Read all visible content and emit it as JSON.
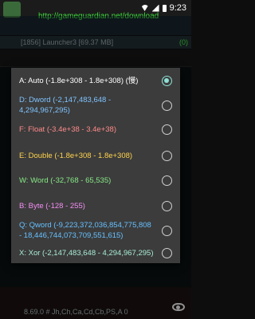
{
  "status_bar": {
    "time": "9:23"
  },
  "background": {
    "url": "http://gameguardian.net/download",
    "process": "[1856] Launcher3 [69.37 MB]",
    "count": "(0)",
    "bottom_text": "8.69.0 # Jh,Ch,Ca,Cd,Cb,PS,A 0"
  },
  "dialog": {
    "options": [
      {
        "label": "A: Auto (-1.8e+308 - 1.8e+308) (慢)",
        "color": "#ffffff",
        "selected": true
      },
      {
        "label": "D: Dword (-2,147,483,648 - 4,294,967,295)",
        "color": "#7fc4ff",
        "selected": false
      },
      {
        "label": "F: Float (-3.4e+38 - 3.4e+38)",
        "color": "#ff8a8a",
        "selected": false
      },
      {
        "label": "E: Double (-1.8e+308 - 1.8e+308)",
        "color": "#ffd34d",
        "selected": false
      },
      {
        "label": "W: Word (-32,768 - 65,535)",
        "color": "#86e986",
        "selected": false
      },
      {
        "label": "B: Byte (-128 - 255)",
        "color": "#f48ef4",
        "selected": false
      },
      {
        "label": "Q: Qword (-9,223,372,036,854,775,808 - 18,446,744,073,709,551,615)",
        "color": "#66c0ff",
        "selected": false
      },
      {
        "label": "X: Xor (-2,147,483,648 - 4,294,967,295)",
        "color": "#a8ebd6",
        "selected": false
      }
    ]
  }
}
